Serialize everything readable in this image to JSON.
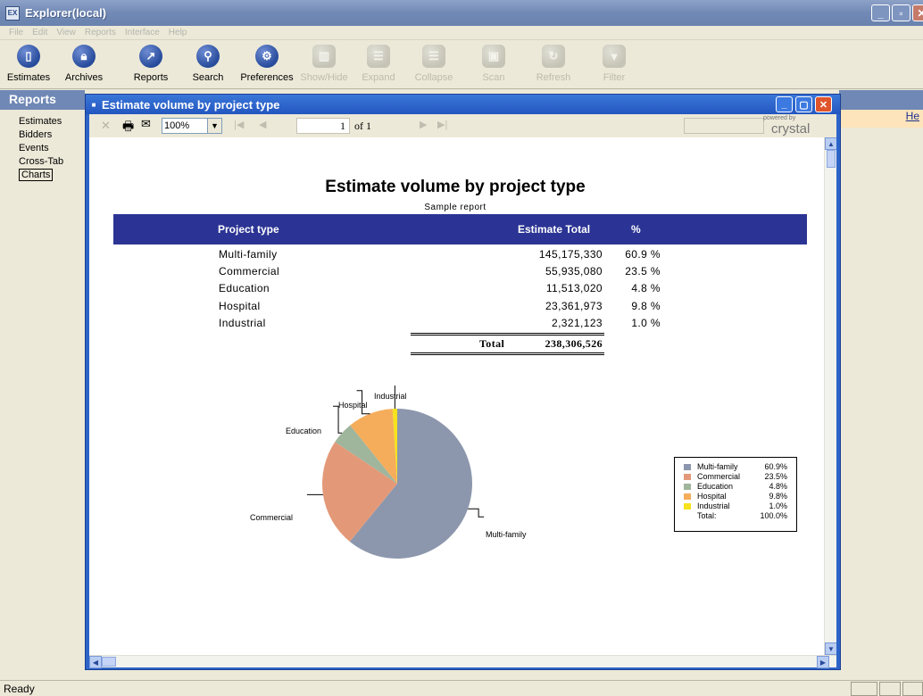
{
  "window": {
    "title": "Explorer(local)",
    "app_icon": "EX"
  },
  "menubar": {
    "items": [
      "File",
      "Edit",
      "View",
      "Reports",
      "Interface",
      "Help"
    ]
  },
  "toolbar": {
    "buttons": [
      {
        "label": "Estimates",
        "icon": "document-icon",
        "enabled": true
      },
      {
        "label": "Archives",
        "icon": "lock-icon",
        "enabled": true
      },
      {
        "label": "Reports",
        "icon": "chart-icon",
        "enabled": true
      },
      {
        "label": "Search",
        "icon": "magnifier-icon",
        "enabled": true
      },
      {
        "label": "Preferences",
        "icon": "gears-icon",
        "enabled": true
      },
      {
        "label": "Show/Hide",
        "icon": "panel-icon",
        "enabled": false
      },
      {
        "label": "Expand",
        "icon": "expand-icon",
        "enabled": false
      },
      {
        "label": "Collapse",
        "icon": "collapse-icon",
        "enabled": false
      },
      {
        "label": "Scan",
        "icon": "scan-icon",
        "enabled": false
      },
      {
        "label": "Refresh",
        "icon": "refresh-icon",
        "enabled": false
      },
      {
        "label": "Filter",
        "icon": "filter-icon",
        "enabled": false
      }
    ]
  },
  "leftpanel": {
    "header": "Reports",
    "items": [
      "Estimates",
      "Bidders",
      "Events",
      "Cross-Tab",
      "Charts"
    ],
    "selected": "Charts"
  },
  "rightstrip": {
    "link": "He"
  },
  "child_window": {
    "title": "Estimate volume by project type",
    "viewer": {
      "zoom": "100%",
      "page": "1",
      "page_of": "of 1",
      "powered_by": "powered by",
      "brand": "crystal"
    }
  },
  "report": {
    "title": "Estimate volume by project type",
    "subtitle": "Sample report",
    "columns": [
      "Project type",
      "Estimate Total",
      "%"
    ],
    "rows": [
      {
        "type": "Multi-family",
        "total": "145,175,330",
        "pct": "60.9 %"
      },
      {
        "type": "Commercial",
        "total": "55,935,080",
        "pct": "23.5 %"
      },
      {
        "type": "Education",
        "total": "11,513,020",
        "pct": "4.8 %"
      },
      {
        "type": "Hospital",
        "total": "23,361,973",
        "pct": "9.8 %"
      },
      {
        "type": "Industrial",
        "total": "2,321,123",
        "pct": "1.0 %"
      }
    ],
    "total_label": "Total",
    "total_value": "238,306,526"
  },
  "chart_data": {
    "type": "pie",
    "categories": [
      "Multi-family",
      "Commercial",
      "Education",
      "Hospital",
      "Industrial"
    ],
    "values": [
      60.9,
      23.5,
      4.8,
      9.8,
      1.0
    ],
    "colors": [
      "#8c97ad",
      "#e39978",
      "#9fb59c",
      "#f5ad5c",
      "#f6e21d"
    ],
    "legend": {
      "placement": "right",
      "entries": [
        {
          "name": "Multi-family",
          "pct": "60.9%"
        },
        {
          "name": "Commercial",
          "pct": "23.5%"
        },
        {
          "name": "Education",
          "pct": "4.8%"
        },
        {
          "name": "Hospital",
          "pct": "9.8%"
        },
        {
          "name": "Industrial",
          "pct": "1.0%"
        }
      ],
      "total_label": "Total:",
      "total_pct": "100.0%"
    }
  },
  "statusbar": {
    "text": "Ready"
  }
}
